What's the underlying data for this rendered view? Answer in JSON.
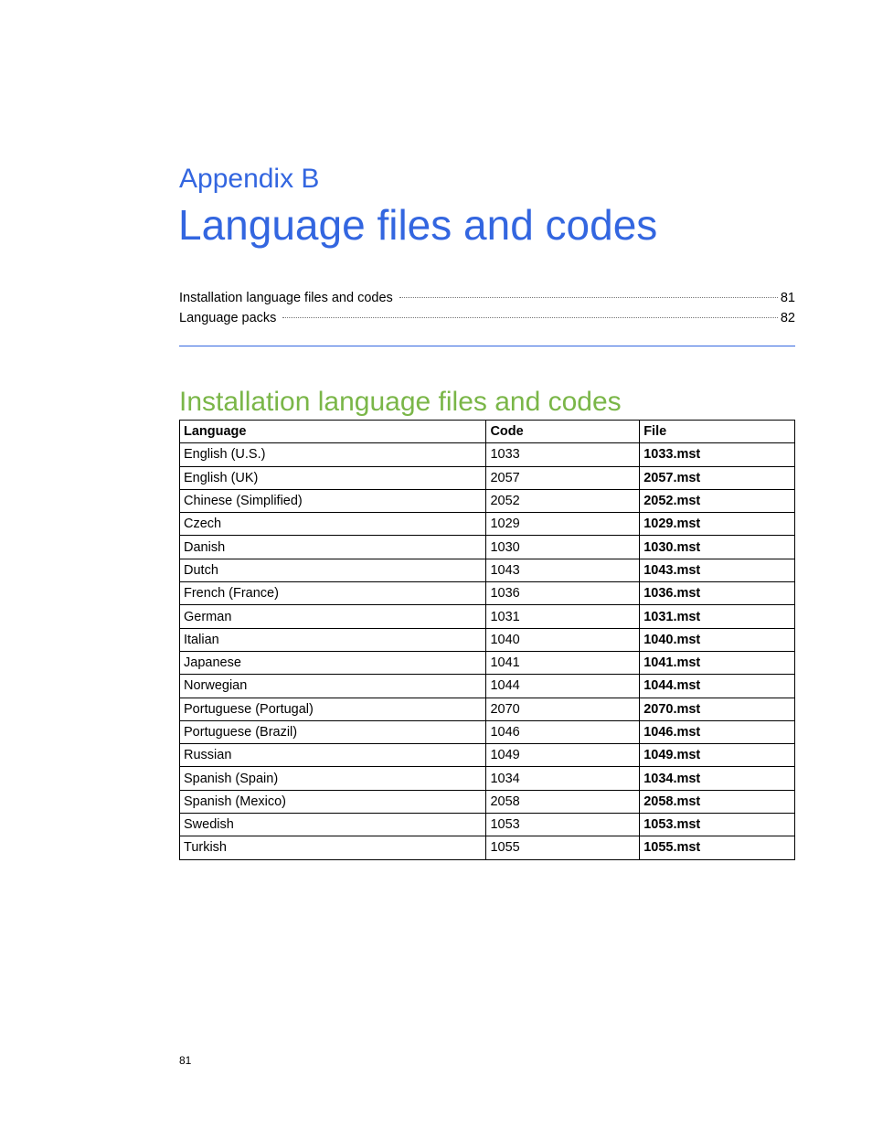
{
  "header": {
    "appendix": "Appendix B",
    "title": "Language files and codes"
  },
  "toc": [
    {
      "text": "Installation language files and codes",
      "page": "81"
    },
    {
      "text": "Language packs",
      "page": "82"
    }
  ],
  "section": {
    "title": "Installation language files and codes"
  },
  "table": {
    "headers": [
      "Language",
      "Code",
      "File"
    ],
    "rows": [
      [
        "English (U.S.)",
        "1033",
        "1033.mst"
      ],
      [
        "English (UK)",
        "2057",
        "2057.mst"
      ],
      [
        "Chinese (Simplified)",
        "2052",
        "2052.mst"
      ],
      [
        "Czech",
        "1029",
        "1029.mst"
      ],
      [
        "Danish",
        "1030",
        "1030.mst"
      ],
      [
        "Dutch",
        "1043",
        "1043.mst"
      ],
      [
        "French (France)",
        "1036",
        "1036.mst"
      ],
      [
        "German",
        "1031",
        "1031.mst"
      ],
      [
        "Italian",
        "1040",
        "1040.mst"
      ],
      [
        "Japanese",
        "1041",
        "1041.mst"
      ],
      [
        "Norwegian",
        "1044",
        "1044.mst"
      ],
      [
        "Portuguese (Portugal)",
        "2070",
        "2070.mst"
      ],
      [
        "Portuguese (Brazil)",
        "1046",
        "1046.mst"
      ],
      [
        "Russian",
        "1049",
        "1049.mst"
      ],
      [
        "Spanish (Spain)",
        "1034",
        "1034.mst"
      ],
      [
        "Spanish (Mexico)",
        "2058",
        "2058.mst"
      ],
      [
        "Swedish",
        "1053",
        "1053.mst"
      ],
      [
        "Turkish",
        "1055",
        "1055.mst"
      ]
    ]
  },
  "footer": {
    "page_number": "81"
  },
  "colors": {
    "heading_blue": "#3366e0",
    "section_green": "#7ab648"
  }
}
